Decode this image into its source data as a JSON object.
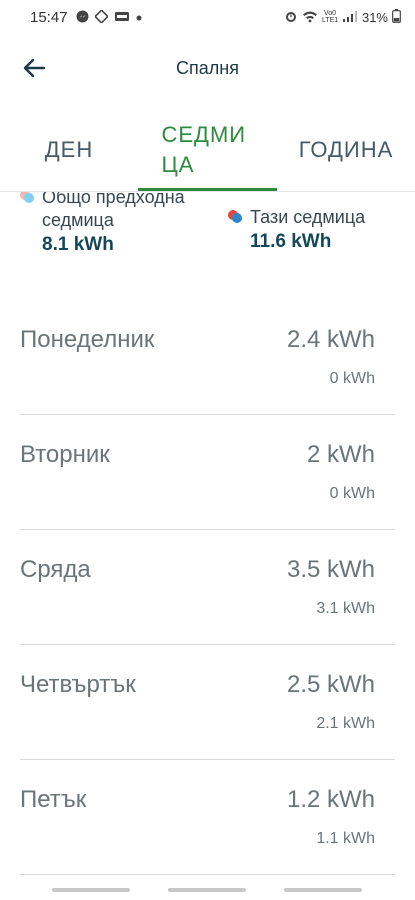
{
  "status_bar": {
    "time": "15:47",
    "battery": "31%",
    "network_label": "Vo0 LTE1"
  },
  "app_bar": {
    "title": "Спалня",
    "back_icon": "arrow-left-icon"
  },
  "tabs": [
    {
      "label": "ДЕН",
      "selected": false
    },
    {
      "label": "СЕДМИЦА",
      "selected": true
    },
    {
      "label": "ГОДИНА",
      "selected": false
    }
  ],
  "colors": {
    "accent": "#2e8b3e",
    "value_dark": "#12485a",
    "dot_blue": "#2a86c8",
    "dot_light_blue": "#7fd0f0",
    "dot_red": "#e8453c",
    "dot_pink": "#f5b8b0"
  },
  "legend": {
    "previous": {
      "label": "Общо предходна седмица",
      "value": "8.1 kWh"
    },
    "current": {
      "label": "Тази седмица",
      "value": "11.6 kWh"
    }
  },
  "days": [
    {
      "name": "Понеделник",
      "value": "2.4 kWh",
      "previous": "0 kWh"
    },
    {
      "name": "Вторник",
      "value": "2 kWh",
      "previous": "0 kWh"
    },
    {
      "name": "Сряда",
      "value": "3.5 kWh",
      "previous": "3.1 kWh"
    },
    {
      "name": "Четвъртък",
      "value": "2.5 kWh",
      "previous": "2.1 kWh"
    },
    {
      "name": "Петък",
      "value": "1.2 kWh",
      "previous": "1.1 kWh"
    }
  ]
}
